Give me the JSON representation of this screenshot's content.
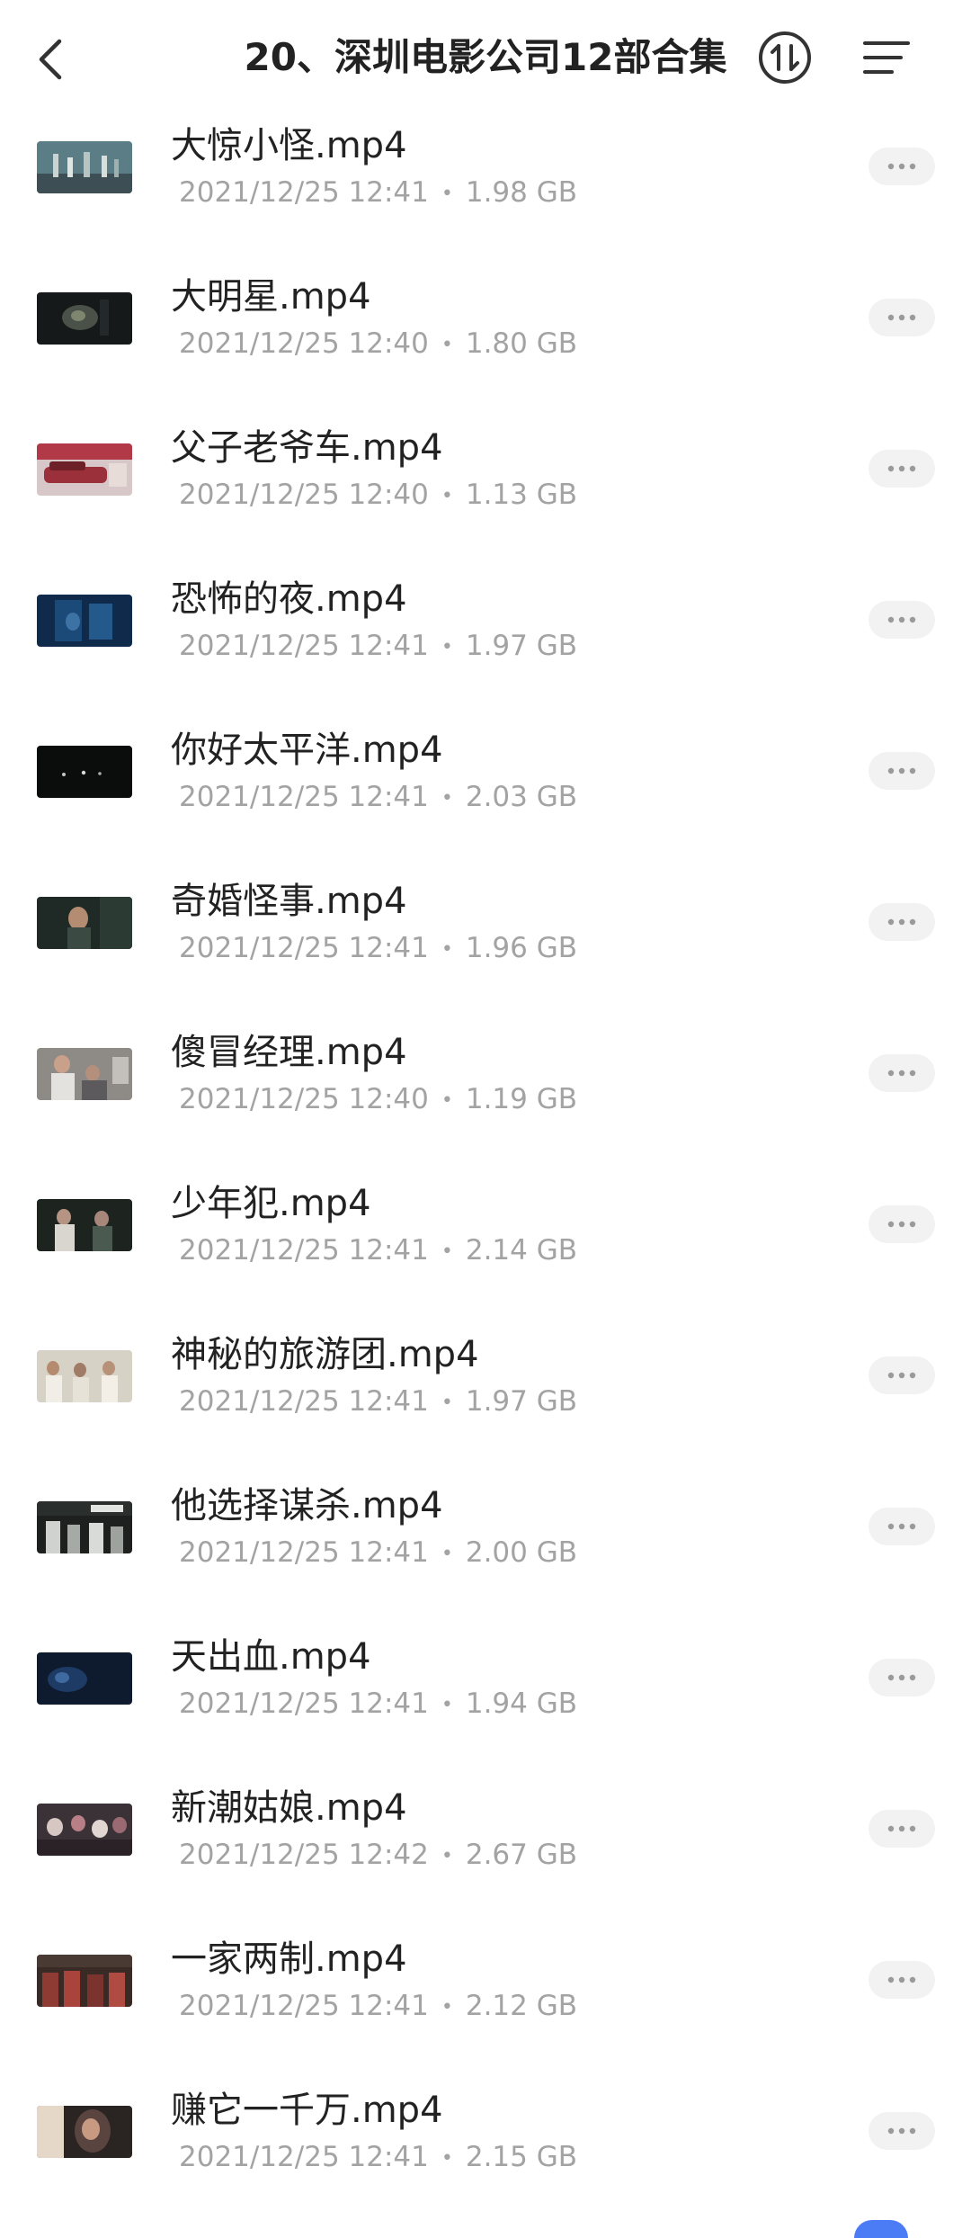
{
  "header": {
    "title": "20、深圳电影公司12部合集"
  },
  "files": [
    {
      "name": "大惊小怪.mp4",
      "date": "2021/12/25 12:41",
      "size": "1.98 GB",
      "thumb": "thumb-street-crowd"
    },
    {
      "name": "大明星.mp4",
      "date": "2021/12/25 12:40",
      "size": "1.80 GB",
      "thumb": "thumb-dark-scene"
    },
    {
      "name": "父子老爷车.mp4",
      "date": "2021/12/25 12:40",
      "size": "1.13 GB",
      "thumb": "thumb-red-car"
    },
    {
      "name": "恐怖的夜.mp4",
      "date": "2021/12/25 12:41",
      "size": "1.97 GB",
      "thumb": "thumb-blue-night"
    },
    {
      "name": "你好太平洋.mp4",
      "date": "2021/12/25 12:41",
      "size": "2.03 GB",
      "thumb": "thumb-black-lights"
    },
    {
      "name": "奇婚怪事.mp4",
      "date": "2021/12/25 12:41",
      "size": "1.96 GB",
      "thumb": "thumb-woman-dark"
    },
    {
      "name": "傻冒经理.mp4",
      "date": "2021/12/25 12:40",
      "size": "1.19 GB",
      "thumb": "thumb-office-men"
    },
    {
      "name": "少年犯.mp4",
      "date": "2021/12/25 12:41",
      "size": "2.14 GB",
      "thumb": "thumb-two-figures"
    },
    {
      "name": "神秘的旅游团.mp4",
      "date": "2021/12/25 12:41",
      "size": "1.97 GB",
      "thumb": "thumb-tour-group"
    },
    {
      "name": "他选择谋杀.mp4",
      "date": "2021/12/25 12:41",
      "size": "2.00 GB",
      "thumb": "thumb-title-card"
    },
    {
      "name": "天出血.mp4",
      "date": "2021/12/25 12:41",
      "size": "1.94 GB",
      "thumb": "thumb-blue-dark"
    },
    {
      "name": "新潮姑娘.mp4",
      "date": "2021/12/25 12:42",
      "size": "2.67 GB",
      "thumb": "thumb-crowd-scene"
    },
    {
      "name": "一家两制.mp4",
      "date": "2021/12/25 12:41",
      "size": "2.12 GB",
      "thumb": "thumb-red-group"
    },
    {
      "name": "赚它一千万.mp4",
      "date": "2021/12/25 12:41",
      "size": "2.15 GB",
      "thumb": "thumb-portrait"
    }
  ],
  "colors": {
    "background": "#ffffff",
    "title_text": "#222222",
    "meta_text": "#a3a3a3",
    "more_button_bg": "#f2f2f2",
    "icon_stroke": "#333333"
  }
}
